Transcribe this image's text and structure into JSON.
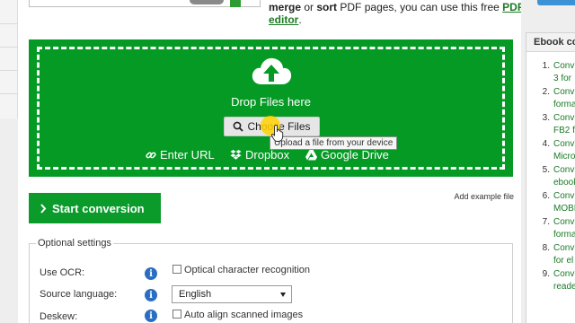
{
  "intro": {
    "line1_parts": [
      "merge",
      " or ",
      "sort",
      " PDF pages, you can use this free "
    ],
    "link_text_1": "PDF",
    "link_text_2": "editor",
    "line2_suffix": "."
  },
  "uploader": {
    "drop_text": "Drop Files here",
    "choose_label": "Choose Files",
    "tooltip": "Upload a file from your device",
    "sources": [
      {
        "label": "Enter URL",
        "icon": "link-icon"
      },
      {
        "label": "Dropbox",
        "icon": "dropbox-icon"
      },
      {
        "label": "Google Drive",
        "icon": "google-drive-icon"
      }
    ],
    "colors": {
      "zone": "#059a24",
      "border": "#ffffff"
    }
  },
  "actions": {
    "start_label": "Start conversion",
    "example_label": "Add example file"
  },
  "optional": {
    "legend": "Optional settings",
    "ocr_label": "Use OCR:",
    "ocr_option": "Optical character recognition",
    "lang_label": "Source language:",
    "lang_value": "English",
    "deskew_label": "Deskew:",
    "deskew_option": "Auto align scanned images"
  },
  "sidebar": {
    "title": "Ebook co",
    "items": [
      {
        "num": "1.",
        "lines": [
          "Conv",
          "3 for"
        ]
      },
      {
        "num": "2.",
        "lines": [
          "Conv",
          "forma"
        ]
      },
      {
        "num": "3.",
        "lines": [
          "Conv",
          "FB2 f"
        ]
      },
      {
        "num": "4.",
        "lines": [
          "Conv",
          "Micro"
        ]
      },
      {
        "num": "5.",
        "lines": [
          "Conv",
          "ebook"
        ]
      },
      {
        "num": "6.",
        "lines": [
          "Conv",
          "MOBI"
        ]
      },
      {
        "num": "7.",
        "lines": [
          "Conv",
          "forma"
        ]
      },
      {
        "num": "8.",
        "lines": [
          "Conv",
          "for el"
        ]
      },
      {
        "num": "9.",
        "lines": [
          "Conv",
          "reade"
        ]
      }
    ]
  }
}
